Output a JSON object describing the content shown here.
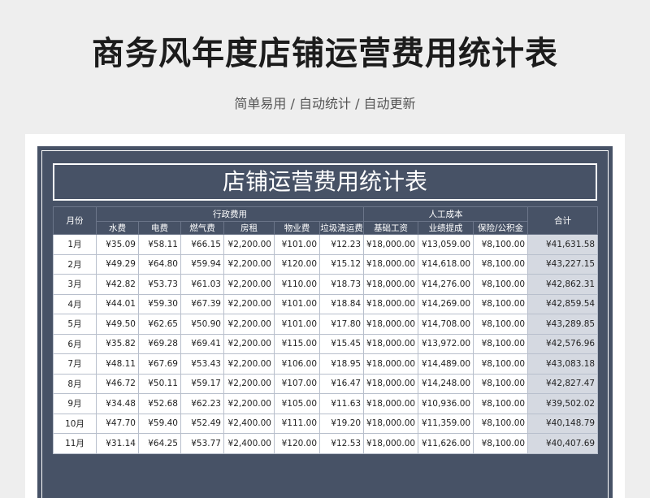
{
  "header": {
    "title": "商务风年度店铺运营费用统计表",
    "subtitle": "简单易用 / 自动统计 / 自动更新"
  },
  "sheet": {
    "title": "店铺运营费用统计表",
    "group_headers": {
      "month": "月份",
      "admin": "行政费用",
      "labor": "人工成本",
      "total": "合计"
    },
    "columns": [
      "水费",
      "电费",
      "燃气费",
      "房租",
      "物业费",
      "垃圾清运费",
      "基础工资",
      "业绩提成",
      "保险/公积金"
    ],
    "rows": [
      [
        "1月",
        "¥35.09",
        "¥58.11",
        "¥66.15",
        "¥2,200.00",
        "¥101.00",
        "¥12.23",
        "¥18,000.00",
        "¥13,059.00",
        "¥8,100.00",
        "¥41,631.58"
      ],
      [
        "2月",
        "¥49.29",
        "¥64.80",
        "¥59.94",
        "¥2,200.00",
        "¥120.00",
        "¥15.12",
        "¥18,000.00",
        "¥14,618.00",
        "¥8,100.00",
        "¥43,227.15"
      ],
      [
        "3月",
        "¥42.82",
        "¥53.73",
        "¥61.03",
        "¥2,200.00",
        "¥110.00",
        "¥18.73",
        "¥18,000.00",
        "¥14,276.00",
        "¥8,100.00",
        "¥42,862.31"
      ],
      [
        "4月",
        "¥44.01",
        "¥59.30",
        "¥67.39",
        "¥2,200.00",
        "¥101.00",
        "¥18.84",
        "¥18,000.00",
        "¥14,269.00",
        "¥8,100.00",
        "¥42,859.54"
      ],
      [
        "5月",
        "¥49.50",
        "¥62.65",
        "¥50.90",
        "¥2,200.00",
        "¥101.00",
        "¥17.80",
        "¥18,000.00",
        "¥14,708.00",
        "¥8,100.00",
        "¥43,289.85"
      ],
      [
        "6月",
        "¥35.82",
        "¥69.28",
        "¥69.41",
        "¥2,200.00",
        "¥115.00",
        "¥15.45",
        "¥18,000.00",
        "¥13,972.00",
        "¥8,100.00",
        "¥42,576.96"
      ],
      [
        "7月",
        "¥48.11",
        "¥67.69",
        "¥53.43",
        "¥2,200.00",
        "¥106.00",
        "¥18.95",
        "¥18,000.00",
        "¥14,489.00",
        "¥8,100.00",
        "¥43,083.18"
      ],
      [
        "8月",
        "¥46.72",
        "¥50.11",
        "¥59.17",
        "¥2,200.00",
        "¥107.00",
        "¥16.47",
        "¥18,000.00",
        "¥14,248.00",
        "¥8,100.00",
        "¥42,827.47"
      ],
      [
        "9月",
        "¥34.48",
        "¥52.68",
        "¥62.23",
        "¥2,200.00",
        "¥105.00",
        "¥11.63",
        "¥18,000.00",
        "¥10,936.00",
        "¥8,100.00",
        "¥39,502.02"
      ],
      [
        "10月",
        "¥47.70",
        "¥59.40",
        "¥52.49",
        "¥2,400.00",
        "¥111.00",
        "¥19.20",
        "¥18,000.00",
        "¥11,359.00",
        "¥8,100.00",
        "¥40,148.79"
      ],
      [
        "11月",
        "¥31.14",
        "¥64.25",
        "¥53.77",
        "¥2,400.00",
        "¥120.00",
        "¥12.53",
        "¥18,000.00",
        "¥11,626.00",
        "¥8,100.00",
        "¥40,407.69"
      ]
    ]
  }
}
